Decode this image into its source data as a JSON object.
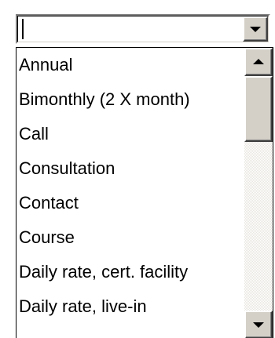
{
  "combo": {
    "value": ""
  },
  "list": {
    "items": [
      "Annual",
      "Bimonthly (2 X month)",
      "Call",
      "Consultation",
      "Contact",
      "Course",
      "Daily rate, cert. facility",
      "Daily rate, live-in"
    ]
  },
  "scrollbar": {
    "position": 0
  },
  "icons": {
    "combo_arrow": "chevron-down-icon",
    "scroll_up": "arrow-up-icon",
    "scroll_down": "arrow-down-icon"
  },
  "colors": {
    "face": "#d4d0c8",
    "background": "#ffffff",
    "text": "#000000"
  }
}
